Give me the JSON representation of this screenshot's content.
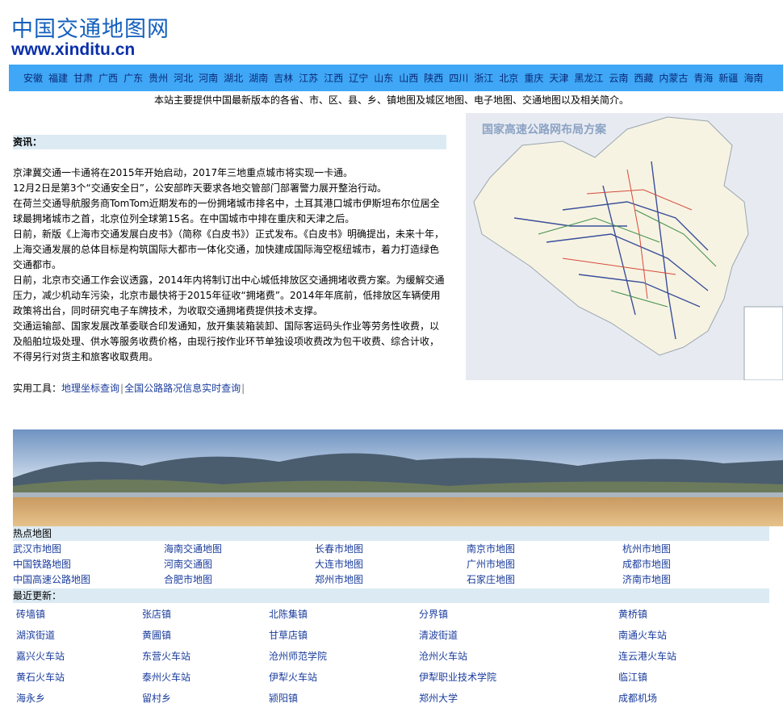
{
  "header": {
    "logo_text": "中国交通地图网",
    "logo_url": "www.xinditu.cn"
  },
  "nav": {
    "provinces": [
      "安徽",
      "福建",
      "甘肃",
      "广西",
      "广东",
      "贵州",
      "河北",
      "河南",
      "湖北",
      "湖南",
      "吉林",
      "江苏",
      "江西",
      "辽宁",
      "山东",
      "山西",
      "陕西",
      "四川",
      "浙江",
      "北京",
      "重庆",
      "天津",
      "黑龙江",
      "云南",
      "西藏",
      "内蒙古",
      "青海",
      "新疆",
      "海南"
    ]
  },
  "intro": "本站主要提供中国最新版本的各省、市、区、县、乡、镇地图及城区地图、电子地图、交通地图以及相关简介。",
  "news": {
    "header": "资讯：",
    "items": [
      "京津冀交通一卡通将在2015年开始启动，2017年三地重点城市将实现一卡通。",
      "12月2日是第3个“交通安全日”，公安部昨天要求各地交管部门部署警力展开整治行动。",
      "在荷兰交通导航服务商TomTom近期发布的一份拥堵城市排名中，土耳其港口城市伊斯坦布尔位居全球最拥堵城市之首，北京位列全球第15名。在中国城市中排在重庆和天津之后。",
      "日前，新版《上海市交通发展白皮书》（简称《白皮书》）正式发布。《白皮书》明确提出，未来十年，上海交通发展的总体目标是构筑国际大都市一体化交通，加快建成国际海空枢纽城市，着力打造绿色交通都市。",
      "日前，北京市交通工作会议透露，2014年内将制订出中心城低排放区交通拥堵收费方案。为缓解交通压力，减少机动车污染，北京市最快将于2015年征收“拥堵费”。2014年年底前，低排放区车辆使用政策将出台，同时研究电子车牌技术，为收取交通拥堵费提供技术支撑。",
      "交通运输部、国家发展改革委联合印发通知，放开集装箱装卸、国际客运码头作业等劳务性收费，以及船舶垃圾处理、供水等服务收费价格，由现行按作业环节单独设项收费改为包干收费、综合计收，不得另行对货主和旅客收取费用。"
    ]
  },
  "tools": {
    "label": "实用工具：",
    "links": [
      "地理坐标查询",
      "全国公路路况信息实时查询"
    ],
    "separator": "|"
  },
  "map_image": {
    "title": "国家高速公路网布局方案"
  },
  "hot_maps": {
    "header": "热点地图",
    "rows": [
      [
        "武汉市地图",
        "海南交通地图",
        "长春市地图",
        "南京市地图",
        "杭州市地图"
      ],
      [
        "中国铁路地图",
        "河南交通图",
        "大连市地图",
        "广州市地图",
        "成都市地图"
      ],
      [
        "中国高速公路地图",
        "合肥市地图",
        "郑州市地图",
        "石家庄地图",
        "济南市地图"
      ]
    ]
  },
  "recent": {
    "header": "最近更新：",
    "rows": [
      [
        "砖墙镇",
        "张店镇",
        "北陈集镇",
        "分界镇",
        "黄桥镇"
      ],
      [
        "湖滨街道",
        "黄圃镇",
        "甘草店镇",
        "清波街道",
        "南通火车站"
      ],
      [
        "嘉兴火车站",
        "东营火车站",
        "沧州师范学院",
        "沧州火车站",
        "连云港火车站"
      ],
      [
        "黄石火车站",
        "泰州火车站",
        "伊犁火车站",
        "伊犁职业技术学院",
        "临江镇"
      ],
      [
        "海永乡",
        "留村乡",
        "颍阳镇",
        "郑州大学",
        "成都机场"
      ]
    ]
  },
  "colors": {
    "nav_bg": "#3fa7f5",
    "link": "#1a3c9c",
    "section_bg": "#dceaf3",
    "logo_blue": "#1560bd"
  }
}
